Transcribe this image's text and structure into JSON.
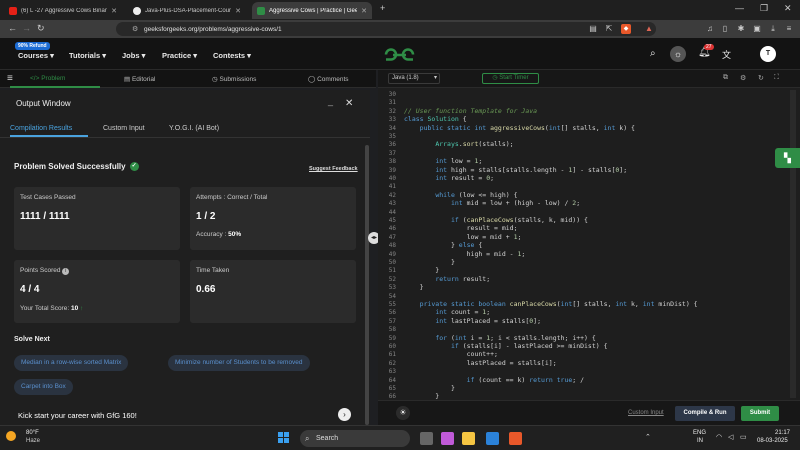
{
  "browser": {
    "tabs": [
      {
        "label": "(6) L -27 Aggressive Cows Binary Se",
        "active": false
      },
      {
        "label": "Java-Plus-DSA-Placement-Course/l",
        "active": false
      },
      {
        "label": "Aggressive Cows | Practice | Gee",
        "active": true
      }
    ],
    "new_tab": "+",
    "url": "geeksforgeeks.org/problems/aggressive-cows/1"
  },
  "gfg_nav": {
    "refund_badge": "90% Refund",
    "menus": [
      "Courses",
      "Tutorials",
      "Jobs",
      "Practice",
      "Contests"
    ],
    "logo_text": "GfG",
    "notif_count": "27",
    "avatar": "T"
  },
  "problem_tabs": [
    "Problem",
    "Editorial",
    "Submissions",
    "Comments"
  ],
  "output_window": {
    "title": "Output Window",
    "tabs": [
      "Compilation Results",
      "Custom Input",
      "Y.O.G.I. (AI Bot)"
    ],
    "status": "Problem Solved Successfully",
    "suggest_feedback": "Suggest Feedback",
    "cards": {
      "tests_label": "Test Cases Passed",
      "tests_value": "1111 / 1111",
      "attempts_label": "Attempts : Correct / Total",
      "attempts_value": "1 / 2",
      "accuracy_label": "Accuracy :",
      "accuracy_value": "50%",
      "points_label": "Points Scored",
      "points_value": "4 / 4",
      "total_score_label": "Your Total Score:",
      "total_score_value": "10",
      "time_label": "Time Taken",
      "time_value": "0.66"
    },
    "solve_next_title": "Solve Next",
    "solve_next": [
      "Median in a row-wise sorted Matrix",
      "Minimize number of Students to be removed",
      "Carpet into Box"
    ],
    "promo": "Kick start your career with GfG 160!"
  },
  "editor": {
    "language": "Java (1.8)",
    "start_timer": "Start Timer",
    "line_numbers": [
      "30",
      "31",
      "32",
      "33",
      "34",
      "35",
      "36",
      "37",
      "38",
      "39",
      "40",
      "41",
      "42",
      "43",
      "44",
      "45",
      "46",
      "47",
      "48",
      "49",
      "50",
      "51",
      "52",
      "53",
      "54",
      "55",
      "56",
      "57",
      "58",
      "59",
      "60",
      "61",
      "62",
      "63",
      "64",
      "65",
      "66"
    ],
    "custom_input": "Custom Input",
    "compile_run": "Compile & Run",
    "submit": "Submit"
  },
  "taskbar": {
    "weather_temp": "80°F",
    "weather_desc": "Haze",
    "search": "Search",
    "lang": "ENG",
    "region": "IN",
    "time": "21:17",
    "date": "08-03-2025"
  }
}
